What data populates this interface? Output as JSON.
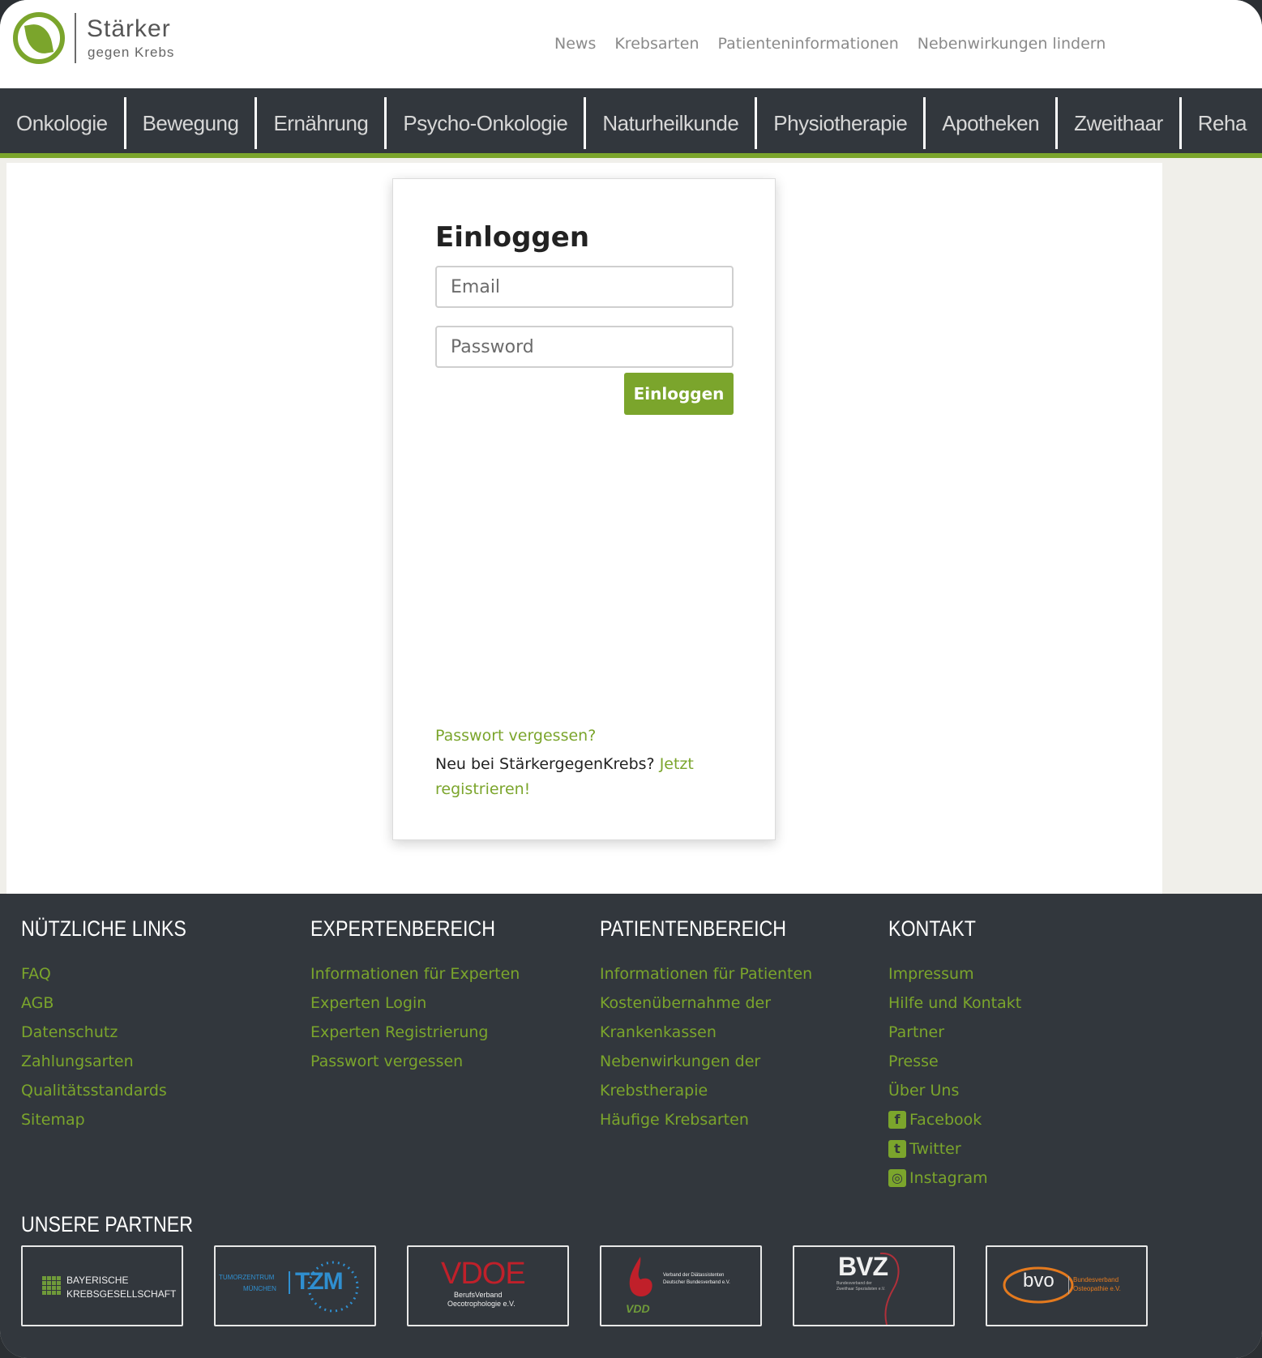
{
  "logo": {
    "line1": "Stärker",
    "line2": "gegen Krebs"
  },
  "top_nav": [
    "News",
    "Krebsarten",
    "Patienteninformationen",
    "Nebenwirkungen lindern"
  ],
  "main_nav": [
    "Onkologie",
    "Bewegung",
    "Ernährung",
    "Psycho-Onkologie",
    "Naturheilkunde",
    "Physiotherapie",
    "Apotheken",
    "Zweithaar",
    "Reha"
  ],
  "login": {
    "title": "Einloggen",
    "email_placeholder": "Email",
    "password_placeholder": "Password",
    "submit_label": "Einloggen",
    "forgot_label": "Passwort vergessen?",
    "new_user_text": "Neu bei StärkergegenKrebs?",
    "register_label": "Jetzt registrieren!"
  },
  "footer": {
    "columns": [
      {
        "title": "NÜTZLICHE LINKS",
        "links": [
          "FAQ",
          "AGB",
          "Datenschutz",
          "Zahlungsarten",
          "Qualitätsstandards",
          "Sitemap"
        ]
      },
      {
        "title": "EXPERTENBEREICH",
        "links": [
          "Informationen für Experten",
          "Experten Login",
          "Experten Registrierung",
          "Passwort vergessen"
        ]
      },
      {
        "title": "PATIENTENBEREICH",
        "links": [
          "Informationen für Patienten",
          "Kostenübernahme der",
          "Krankenkassen",
          "Nebenwirkungen der",
          "Krebstherapie",
          "Häufige Krebsarten"
        ]
      },
      {
        "title": "KONTAKT",
        "links": [
          "Impressum",
          "Hilfe und Kontakt",
          "Partner",
          "Presse",
          "Über Uns"
        ],
        "social": [
          {
            "label": "Facebook",
            "icon": "facebook-icon"
          },
          {
            "label": "Twitter",
            "icon": "twitter-icon"
          },
          {
            "label": "Instagram",
            "icon": "instagram-icon"
          }
        ]
      }
    ],
    "partners_title": "UNSERE PARTNER",
    "partners": [
      {
        "name": "Bayerische Krebsgesellschaft",
        "text1": "BAYERISCHE",
        "text2": "KREBSGESELLSCHAFT"
      },
      {
        "name": "Tumorzentrum München",
        "text1": "TUMORZENTRUM",
        "text2": "MÜNCHEN",
        "mark": "TZM"
      },
      {
        "name": "VDOE",
        "mark": "VDOE",
        "text1": "BerufsVerband",
        "text2": "Oecotrophologie e.V."
      },
      {
        "name": "VDD",
        "mark": "VDD",
        "text1": "Verband der Diätassistenten",
        "text2": "Deutscher Bundesverband e.V."
      },
      {
        "name": "BVZ",
        "mark": "BVZ",
        "text1": "Bundesverband der",
        "text2": "Zweithaar Spezialisten e.V."
      },
      {
        "name": "bvo",
        "mark": "bvo",
        "text1": "Bundesverband",
        "text2": "Osteopathie e.V."
      }
    ]
  },
  "colors": {
    "brand_green": "#7ba52c",
    "nav_dark": "#32373d"
  }
}
